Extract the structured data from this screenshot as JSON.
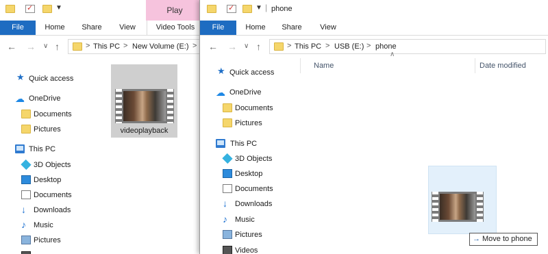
{
  "window1": {
    "context_tab": "Play",
    "ribbon_tabs": [
      "File",
      "Home",
      "Share",
      "View",
      "Video Tools"
    ],
    "breadcrumb": [
      "This PC",
      "New Volume (E:)"
    ],
    "nav_items": [
      "Quick access",
      "OneDrive",
      "Documents",
      "Pictures",
      "This PC",
      "3D Objects",
      "Desktop",
      "Documents",
      "Downloads",
      "Music",
      "Pictures"
    ],
    "file_name": "videoplayback"
  },
  "window2": {
    "title": "phone",
    "ribbon_tabs": [
      "File",
      "Home",
      "Share",
      "View"
    ],
    "breadcrumb": [
      "This PC",
      "USB (E:)",
      "phone"
    ],
    "columns": [
      "Name",
      "Date modified"
    ],
    "nav_items": [
      "Quick access",
      "OneDrive",
      "Documents",
      "Pictures",
      "This PC",
      "3D Objects",
      "Desktop",
      "Documents",
      "Downloads",
      "Music",
      "Pictures",
      "Videos"
    ]
  },
  "drag_tooltip": "Move to phone",
  "icons": {
    "quick_access": "star-icon",
    "onedrive": "cloud-icon",
    "folder": "folder-icon",
    "this_pc": "computer-icon",
    "objects3d": "cube-icon",
    "desktop": "desktop-icon",
    "downloads": "download-arrow-icon",
    "music": "music-note-icon",
    "pictures": "pictures-icon",
    "videos": "videos-icon"
  },
  "colors": {
    "file_tab": "#1e6cc1",
    "context_tab": "#f6c3dd",
    "selection": "#cce4f7"
  }
}
